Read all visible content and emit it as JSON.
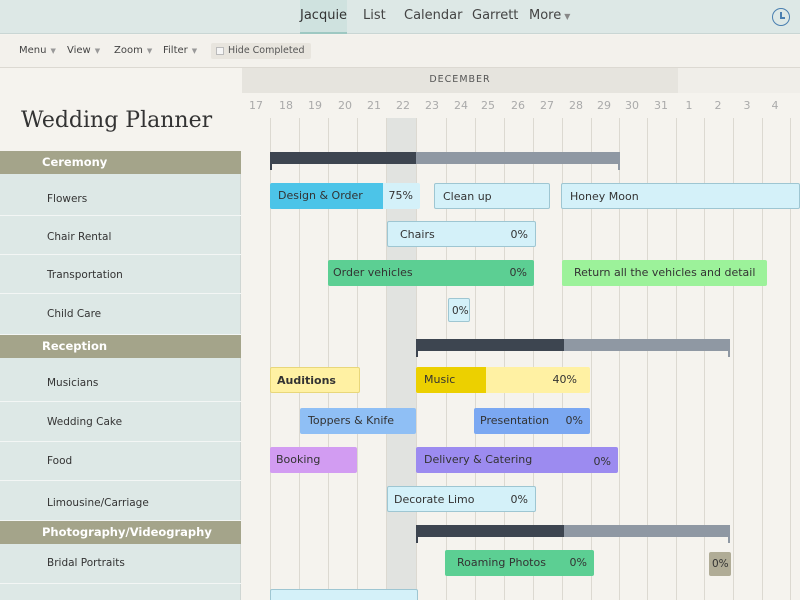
{
  "nav": {
    "tabs": [
      "Jacquie",
      "List",
      "Calendar",
      "Garrett",
      "More"
    ],
    "active": "Jacquie"
  },
  "toolbar": {
    "menu": "Menu",
    "view": "View",
    "zoom": "Zoom",
    "filter": "Filter",
    "hide_completed": "Hide Completed"
  },
  "app_title": "Wedding Planner",
  "groups": {
    "ceremony": "Ceremony",
    "reception": "Reception",
    "photo": "Photography/Videography"
  },
  "tasks": {
    "flowers": "Flowers",
    "chair_rental": "Chair Rental",
    "transportation": "Transportation",
    "child_care": "Child Care",
    "musicians": "Musicians",
    "wedding_cake": "Wedding Cake",
    "food": "Food",
    "limo": "Limousine/Carriage",
    "bridal_portraits": "Bridal Portraits"
  },
  "timeline": {
    "month": "DECEMBER",
    "days": [
      "17",
      "18",
      "19",
      "20",
      "21",
      "22",
      "23",
      "24",
      "25",
      "26",
      "27",
      "28",
      "29",
      "30",
      "31",
      "1",
      "2",
      "3",
      "4"
    ]
  },
  "bars": {
    "design_order": {
      "label": "Design & Order",
      "pct": "75%",
      "progress": 0.75,
      "color": "#4cc4e8",
      "bg": "#d4f1f9"
    },
    "clean_up": {
      "label": "Clean up",
      "color": "#d4f1f9"
    },
    "honey_moon": {
      "label": "Honey Moon",
      "color": "#d4f1f9"
    },
    "chairs": {
      "label": "Chairs",
      "pct": "0%",
      "color": "#d4f1f9"
    },
    "order_vehicles": {
      "label": "Order vehicles",
      "pct": "0%",
      "color": "#5ccf93"
    },
    "return_vehicles": {
      "label": "Return all the vehicles and detail",
      "color": "#9cf29a"
    },
    "child_care_pct": {
      "pct": "0%",
      "color": "#d4f1f9"
    },
    "auditions": {
      "label": "Auditions",
      "color": "#fff1a3"
    },
    "music": {
      "label": "Music",
      "pct": "40%",
      "progress": 0.4,
      "color": "#ecd000",
      "bg": "#fff1a3"
    },
    "toppers_knife": {
      "label": "Toppers & Knife",
      "color": "#8fbff5"
    },
    "presentation": {
      "label": "Presentation",
      "pct": "0%",
      "color": "#7ba8f2"
    },
    "booking": {
      "label": "Booking",
      "color": "#d29cf2"
    },
    "delivery_catering": {
      "label": "Delivery & Catering",
      "pct": "0%",
      "color": "#9c8bf0"
    },
    "decorate_limo": {
      "label": "Decorate Limo",
      "pct": "0%",
      "color": "#d4f1f9"
    },
    "roaming_photos": {
      "label": "Roaming Photos",
      "pct": "0%",
      "color": "#5ccf93"
    },
    "portrait_pct": {
      "pct": "0%",
      "color": "#b0ac96"
    }
  }
}
